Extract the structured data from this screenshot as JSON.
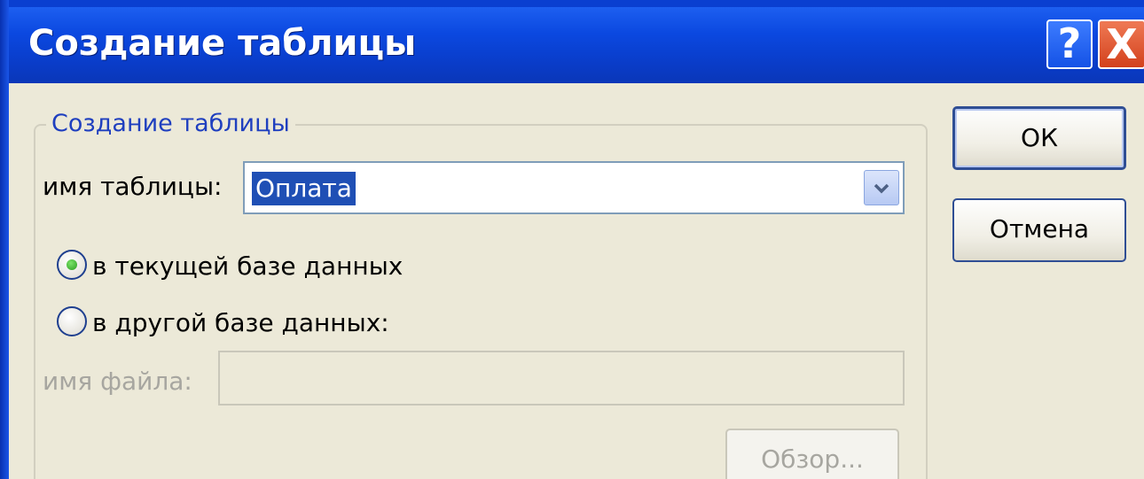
{
  "window": {
    "title": "Создание таблицы",
    "help_label": "?",
    "close_label": "X"
  },
  "group": {
    "legend": "Создание таблицы"
  },
  "table_name": {
    "label": "имя таблицы:",
    "value": "Оплата",
    "dropdown_icon": "chevron-down-icon"
  },
  "options": [
    {
      "label": "в текущей базе данных",
      "selected": true
    },
    {
      "label": "в другой базе данных:",
      "selected": false
    }
  ],
  "file_name": {
    "label": "имя файла:",
    "value": ""
  },
  "buttons": {
    "ok": "ОК",
    "cancel": "Отмена",
    "browse": "Обзор..."
  },
  "colors": {
    "titlebar": "#0a3fd0",
    "dialog_bg": "#ece9d8",
    "selection": "#1f4fb5",
    "close_button": "#d3411c"
  }
}
